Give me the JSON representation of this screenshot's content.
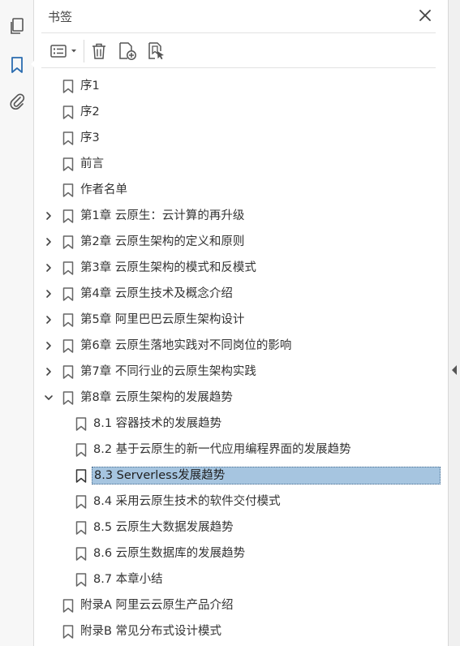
{
  "panel": {
    "title": "书签"
  },
  "rail": {
    "items": [
      {
        "name": "pages-icon"
      },
      {
        "name": "bookmark-icon"
      },
      {
        "name": "attachment-icon"
      }
    ]
  },
  "toolbar": {
    "buttons": [
      "options-menu",
      "delete-bookmark",
      "new-bookmark",
      "new-bookmark-from-structure"
    ]
  },
  "bookmarks": [
    {
      "label": "序1",
      "level": 0,
      "expandable": false,
      "expanded": false
    },
    {
      "label": "序2",
      "level": 0,
      "expandable": false,
      "expanded": false
    },
    {
      "label": "序3",
      "level": 0,
      "expandable": false,
      "expanded": false
    },
    {
      "label": "前言",
      "level": 0,
      "expandable": false,
      "expanded": false
    },
    {
      "label": "作者名单",
      "level": 0,
      "expandable": false,
      "expanded": false
    },
    {
      "label": "第1章 云原生：云计算的再升级",
      "level": 0,
      "expandable": true,
      "expanded": false
    },
    {
      "label": "第2章 云原生架构的定义和原则",
      "level": 0,
      "expandable": true,
      "expanded": false
    },
    {
      "label": "第3章 云原生架构的模式和反模式",
      "level": 0,
      "expandable": true,
      "expanded": false
    },
    {
      "label": "第4章 云原生技术及概念介绍",
      "level": 0,
      "expandable": true,
      "expanded": false
    },
    {
      "label": "第5章 阿里巴巴云原生架构设计",
      "level": 0,
      "expandable": true,
      "expanded": false
    },
    {
      "label": "第6章 云原生落地实践对不同岗位的影响",
      "level": 0,
      "expandable": true,
      "expanded": false
    },
    {
      "label": "第7章 不同行业的云原生架构实践",
      "level": 0,
      "expandable": true,
      "expanded": false
    },
    {
      "label": "第8章 云原生架构的发展趋势",
      "level": 0,
      "expandable": true,
      "expanded": true
    },
    {
      "label": "8.1 容器技术的发展趋势",
      "level": 1,
      "expandable": false,
      "expanded": false
    },
    {
      "label": "8.2 基于云原生的新一代应用编程界面的发展趋势",
      "level": 1,
      "expandable": false,
      "expanded": false
    },
    {
      "label": "8.3 Serverless发展趋势",
      "level": 1,
      "expandable": false,
      "expanded": false,
      "selected": true
    },
    {
      "label": "8.4 采用云原生技术的软件交付模式",
      "level": 1,
      "expandable": false,
      "expanded": false
    },
    {
      "label": "8.5 云原生大数据发展趋势",
      "level": 1,
      "expandable": false,
      "expanded": false
    },
    {
      "label": "8.6 云原生数据库的发展趋势",
      "level": 1,
      "expandable": false,
      "expanded": false
    },
    {
      "label": "8.7 本章小结",
      "level": 1,
      "expandable": false,
      "expanded": false
    },
    {
      "label": "附录A 阿里云云原生产品介绍",
      "level": 0,
      "expandable": false,
      "expanded": false
    },
    {
      "label": "附录B 常见分布式设计模式",
      "level": 0,
      "expandable": false,
      "expanded": false
    }
  ],
  "colors": {
    "selection": "#a6c5e0",
    "accent": "#2b6cb0",
    "icon": "#555555"
  }
}
